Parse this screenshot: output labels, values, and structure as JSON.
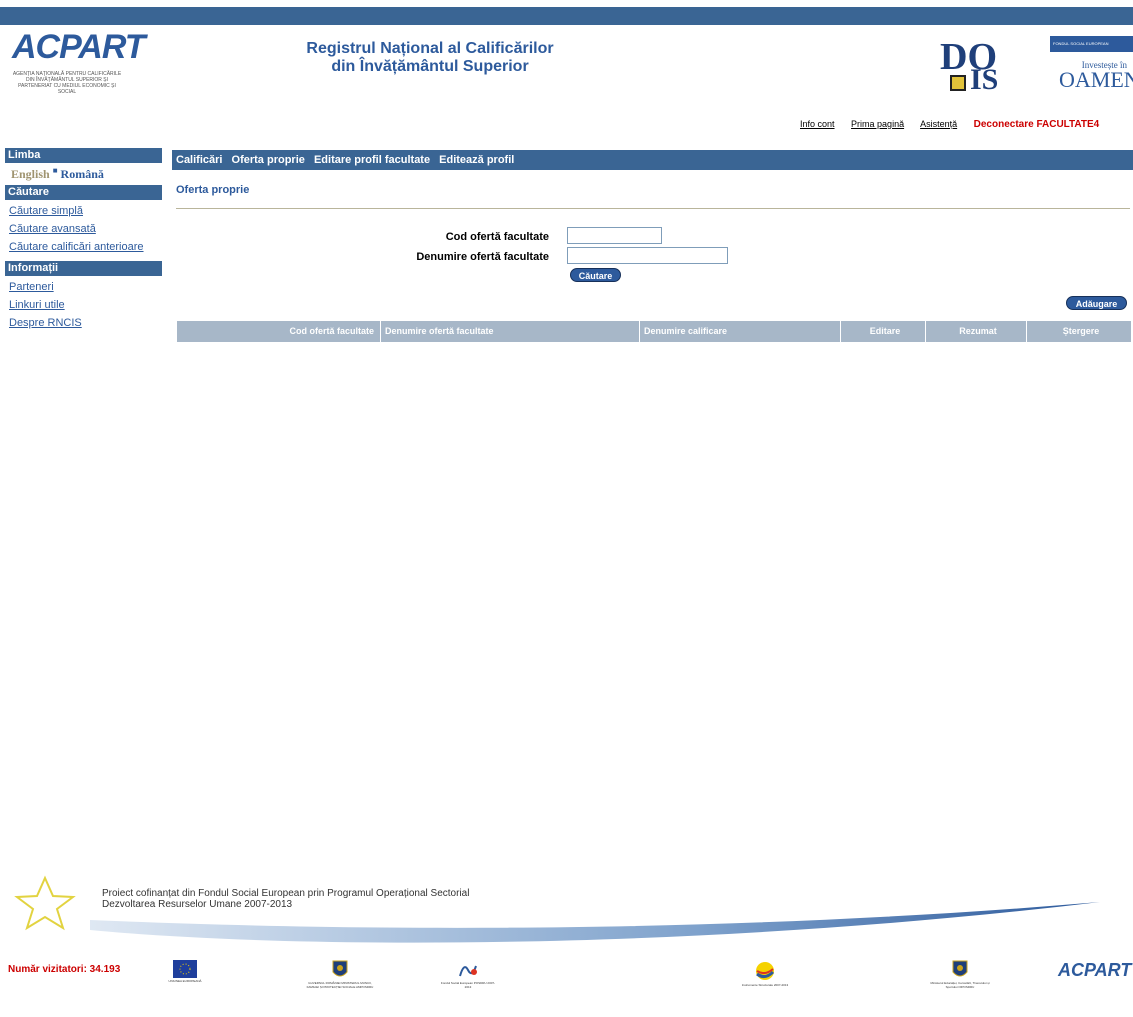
{
  "header": {
    "acpart_logo": "ACPART",
    "acpart_subtitle": "AGENȚIA NAȚIONALĂ PENTRU CALIFICĂRILE DIN ÎNVĂȚĂMÂNTUL SUPERIOR ȘI PARTENERIAT CU MEDIUL ECONOMIC ȘI SOCIAL",
    "title_line1": "Registrul Național al Calificărilor",
    "title_line2": "din Învățământul Superior",
    "docis_logo_d": "DO",
    "docis_logo_is": "IS",
    "fse_box": "FONDUL SOCIAL EUROPEAN",
    "fse_tagline": "Investește în",
    "fse_oameni": "OAMENI"
  },
  "toplinks": {
    "info_cont": "Info cont",
    "prima_pagina": "Prima pagină",
    "asistenta": "Asistență",
    "deconectare": "Deconectare",
    "user": "FACULTATE4"
  },
  "sidebar": {
    "limba_heading": "Limba",
    "english": "English",
    "romana": "Română",
    "cautare_heading": "Căutare",
    "cautare_items": [
      "Căutare simplă",
      "Căutare avansată",
      "Căutare calificări anterioare"
    ],
    "informatii_heading": "Informații",
    "informatii_items": [
      "Parteneri",
      "Linkuri utile",
      "Despre RNCIS"
    ]
  },
  "mainnav": [
    "Calificări",
    "Oferta proprie",
    "Editare profil facultate",
    "Editează profil"
  ],
  "page": {
    "crumb": "Oferta proprie",
    "cod_label": "Cod ofertă facultate",
    "cod_value": "",
    "denumire_label": "Denumire ofertă facultate",
    "denumire_value": "",
    "search_button": "Căutare",
    "add_button": "Adăugare"
  },
  "table": {
    "columns": [
      "Cod ofertă facultate",
      "Denumire ofertă facultate",
      "Denumire calificare",
      "Editare",
      "Rezumat",
      "Ștergere"
    ]
  },
  "footer": {
    "project_line1": "Proiect cofinanțat din Fondul Social European prin Programul Operațional Sectorial",
    "project_line2": "Dezvoltarea Resurselor Umane 2007-2013",
    "visitors": "Număr vizitatori: 34.193",
    "logos": [
      "UNIUNEA EUROPEANĂ",
      "GUVERNUL ROMÂNIEI MINISTERUL MUNCII, FAMILIEI ȘI PROTECȚIEI SOCIALE AMPOSDRU",
      "Fondul Social European POSDRU 2007-2013",
      "Instrumente Structurale 2007-2013",
      "Ministerul Educației, Cercetării, Tineretului și Sportului OIPOSDRU",
      "ACPART"
    ]
  },
  "colors": {
    "nav_blue": "#3a6594",
    "link_blue": "#2d5a9c",
    "alert_red": "#cc0000",
    "table_header": "#a7b7c8"
  }
}
